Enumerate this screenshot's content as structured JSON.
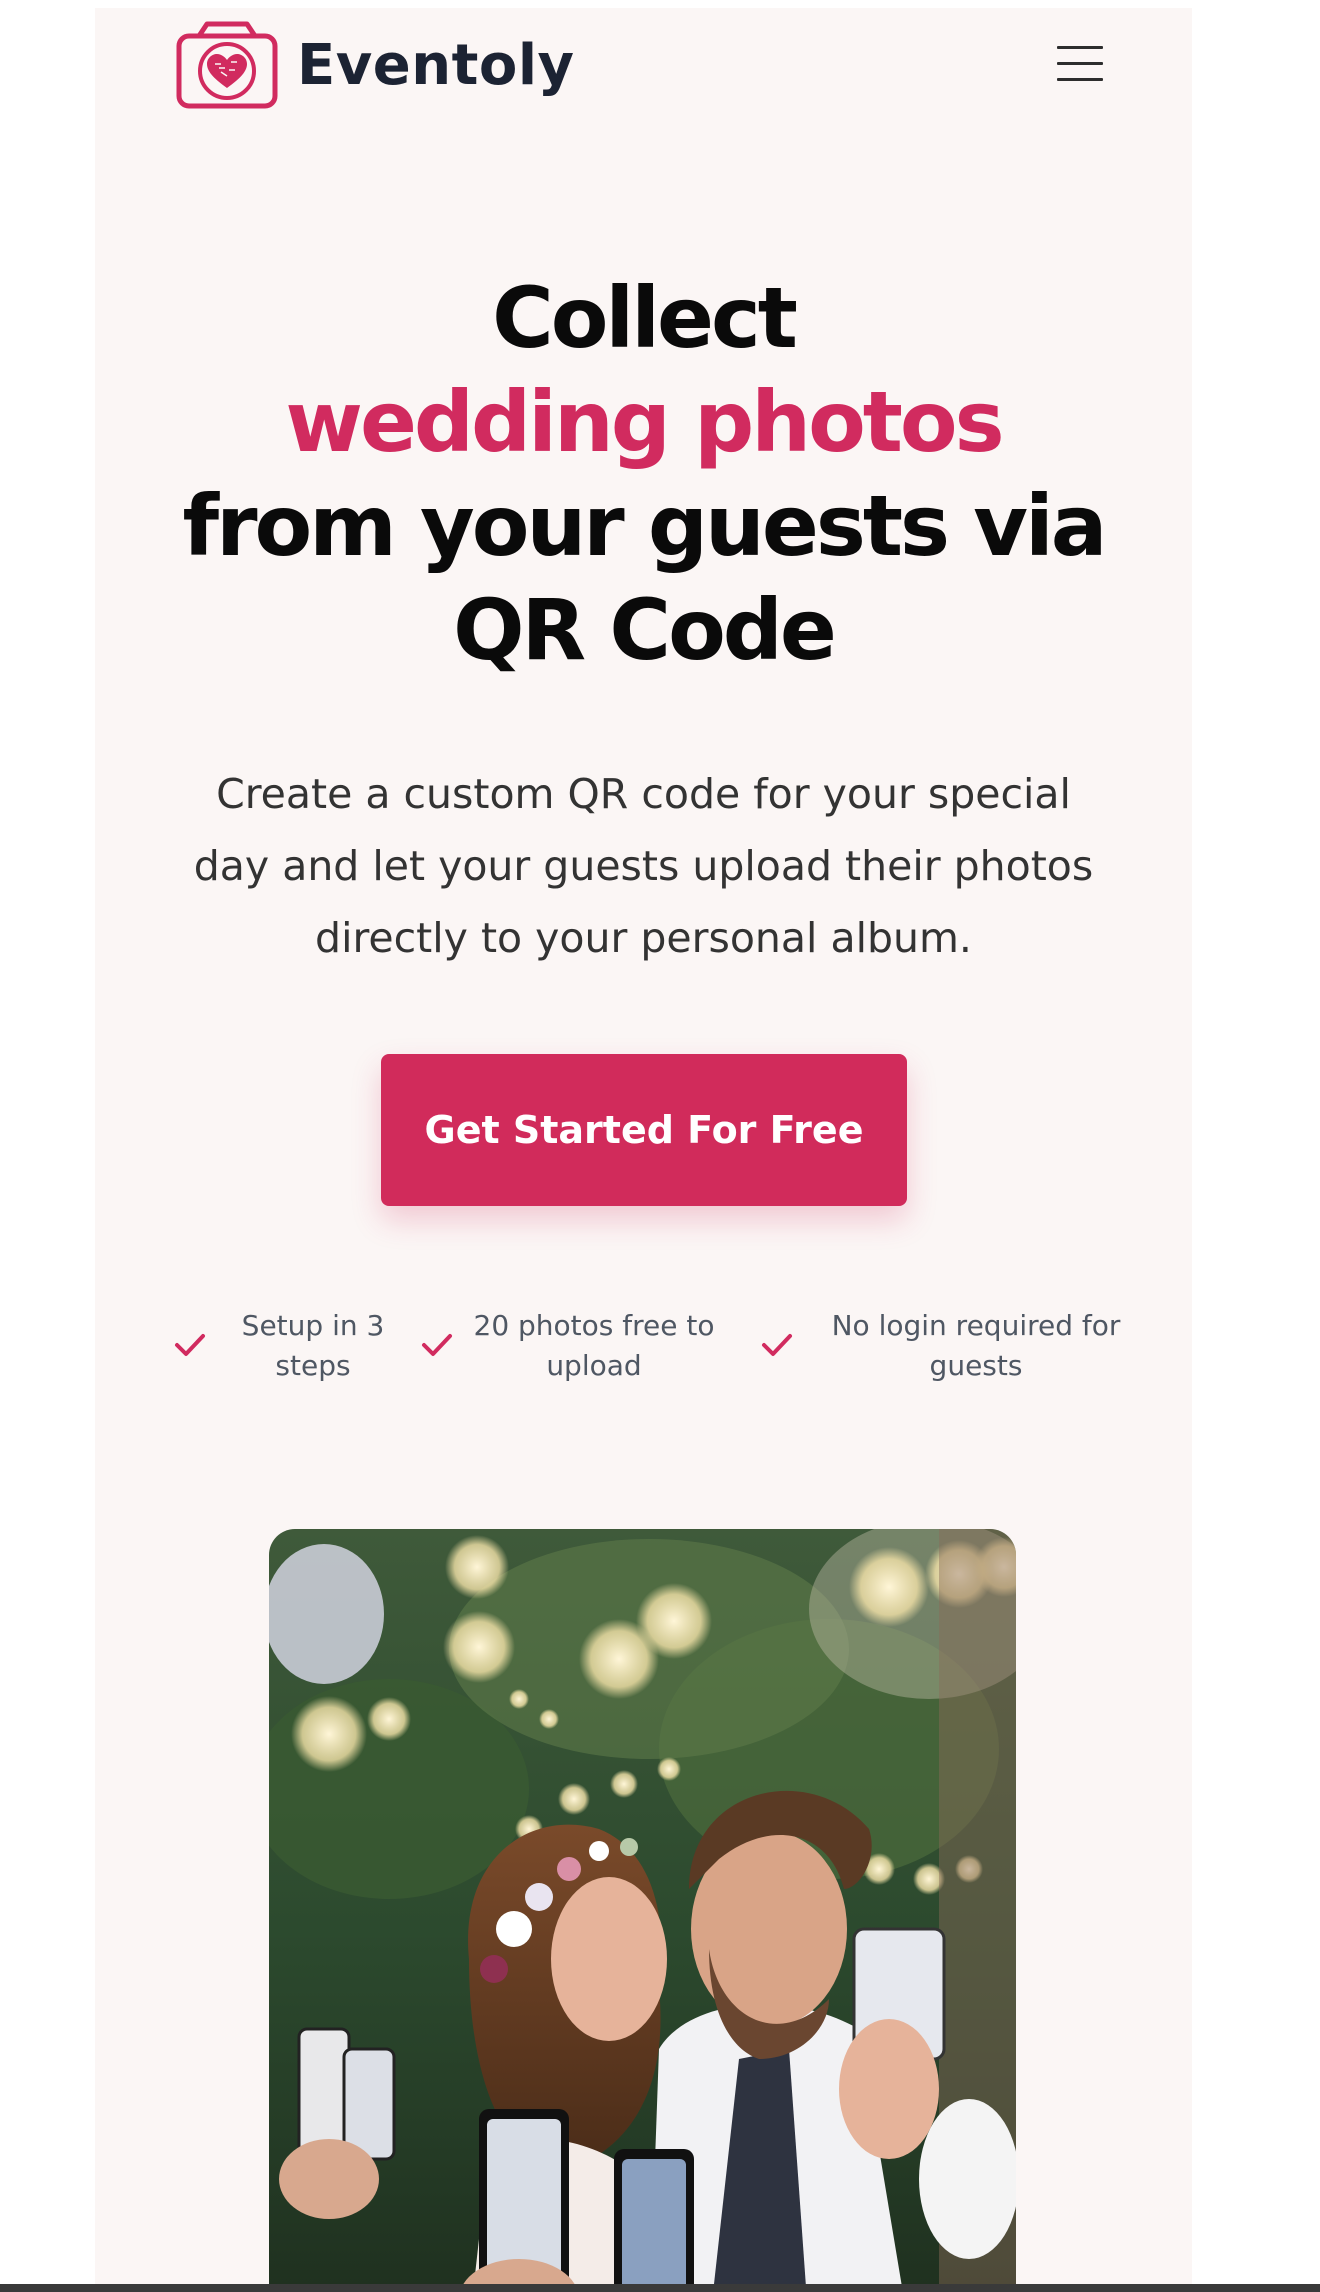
{
  "header": {
    "brand_name": "Eventoly",
    "logo_icon": "camera-heart-icon",
    "menu_icon": "hamburger-menu-icon"
  },
  "hero": {
    "headline_line1": "Collect",
    "headline_accent": "wedding photos",
    "headline_line3": "from your guests via",
    "headline_line4": "QR Code",
    "description": "Create a custom QR code for your special day and let your guests upload their photos directly to your personal album.",
    "cta_label": "Get Started For Free"
  },
  "features": [
    {
      "label": "Setup in 3 steps",
      "icon": "check-icon"
    },
    {
      "label": "20 photos free to upload",
      "icon": "check-icon"
    },
    {
      "label": "No login required for guests",
      "icon": "check-icon"
    }
  ],
  "colors": {
    "accent": "#d12b5f",
    "background": "#fbf6f5",
    "text_dark": "#0a0a0a",
    "text_muted": "#4f5763"
  },
  "hero_image": {
    "description_icon": "wedding-couple-photo"
  }
}
